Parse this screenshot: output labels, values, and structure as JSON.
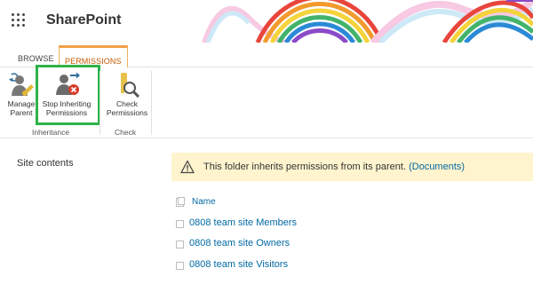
{
  "app": {
    "title": "SharePoint"
  },
  "ribbon": {
    "tabs": [
      {
        "label": "BROWSE"
      },
      {
        "label": "PERMISSIONS"
      }
    ],
    "buttons": {
      "manage": {
        "line1": "Manage",
        "line2": "Parent"
      },
      "stop": {
        "line1": "Stop Inheriting",
        "line2": "Permissions"
      },
      "check": {
        "line1": "Check",
        "line2": "Permissions"
      }
    },
    "groups": {
      "inheritance": "Inheritance",
      "check": "Check"
    }
  },
  "nav": {
    "site_contents": "Site contents"
  },
  "info": {
    "message": "This folder inherits permissions from its parent.",
    "link": "(Documents)"
  },
  "list": {
    "header": {
      "name": "Name"
    },
    "items": [
      {
        "label": "0808 team site Members"
      },
      {
        "label": "0808 team site Owners"
      },
      {
        "label": "0808 team site Visitors"
      }
    ]
  },
  "colors": {
    "accent": "#c25a00",
    "link": "#0369a3",
    "highlight": "#2db34a",
    "info_bg": "#fff4ce"
  }
}
